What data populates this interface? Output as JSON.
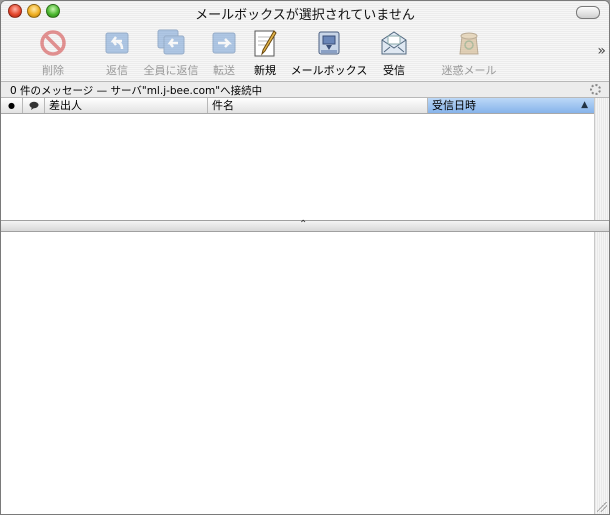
{
  "window": {
    "title": "メールボックスが選択されていません"
  },
  "toolbar": {
    "items": [
      {
        "label": "削除",
        "icon": "delete-icon",
        "enabled": false
      },
      {
        "label": "返信",
        "icon": "reply-icon",
        "enabled": false
      },
      {
        "label": "全員に返信",
        "icon": "reply-all-icon",
        "enabled": false
      },
      {
        "label": "転送",
        "icon": "forward-icon",
        "enabled": false
      },
      {
        "label": "新規",
        "icon": "compose-icon",
        "enabled": true
      },
      {
        "label": "メールボックス",
        "icon": "mailbox-icon",
        "enabled": true
      },
      {
        "label": "受信",
        "icon": "get-mail-icon",
        "enabled": true
      },
      {
        "label": "迷惑メール",
        "icon": "junk-icon",
        "enabled": false
      }
    ],
    "overflow": "»"
  },
  "status": {
    "text": "0 件のメッセージ — サーバ\"ml.j-bee.com\"へ接続中"
  },
  "message_list": {
    "columns": [
      {
        "label": "●",
        "name": "read-status"
      },
      {
        "label": "",
        "name": "comment"
      },
      {
        "label": "差出人",
        "name": "from"
      },
      {
        "label": "件名",
        "name": "subject"
      },
      {
        "label": "受信日時",
        "name": "date-received",
        "sorted": true
      }
    ],
    "sort_arrow": "▲",
    "rows": []
  },
  "splitter": {
    "handle": "⌃"
  }
}
